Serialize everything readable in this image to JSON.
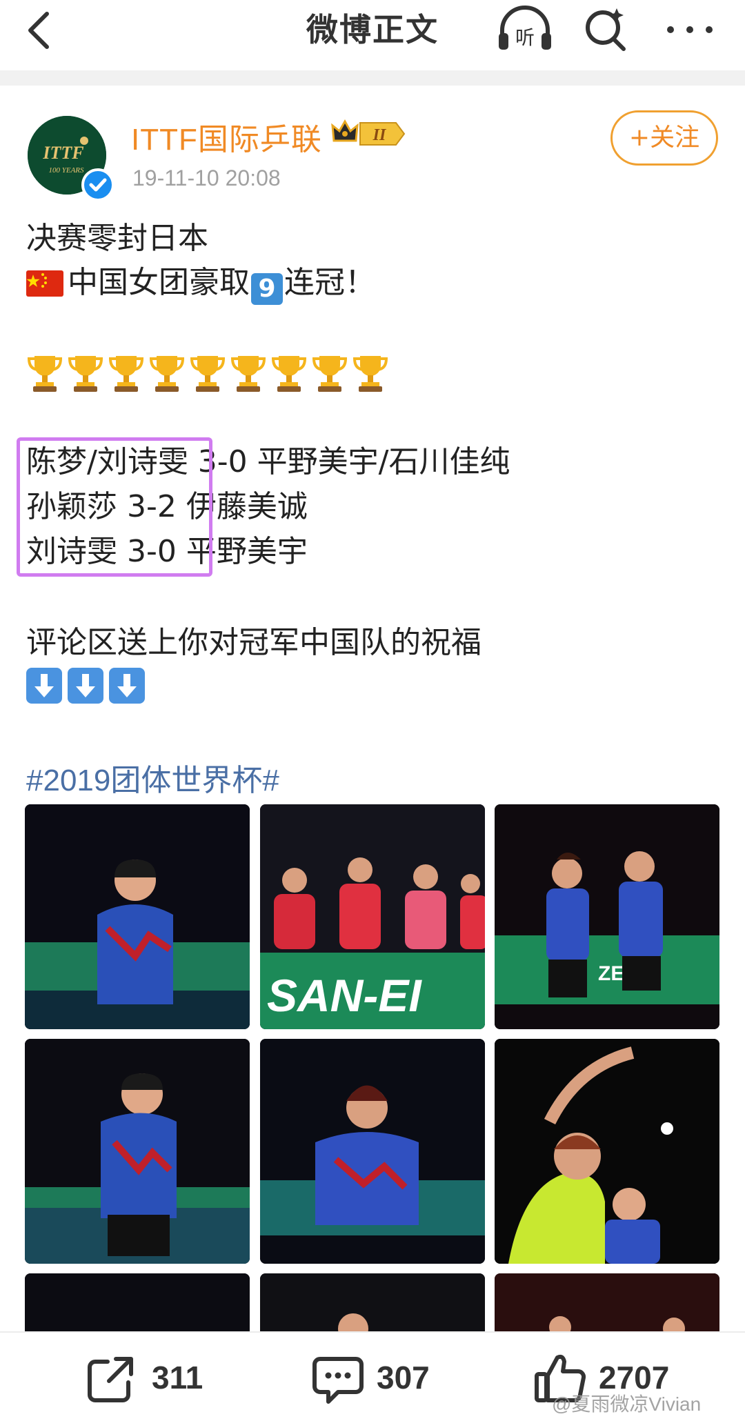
{
  "nav": {
    "title": "微博正文",
    "listen_label": "听"
  },
  "post": {
    "author": "ITTF国际乒联",
    "avatar_text": "ITTF",
    "avatar_subtext": "100 YEARS",
    "badge_level": "II",
    "timestamp": "19-11-10 20:08",
    "follow_label": "+关注",
    "lines": {
      "l1": "决赛零封日本",
      "l2_before": "中国女团豪取",
      "l2_num": "9",
      "l2_after": "连冠！",
      "r1": "陈梦/刘诗雯 3-0 平野美宇/石川佳纯",
      "r2": "孙颖莎 3-2 伊藤美诚",
      "r3": "刘诗雯 3-0 平野美宇",
      "l6": "评论区送上你对冠军中国队的祝福"
    },
    "trophy_count": 9,
    "arrow_count": 3,
    "hashtag": "#2019团体世界杯#",
    "images": [
      {
        "desc": "player-celebrating-1"
      },
      {
        "desc": "coaches-applauding"
      },
      {
        "desc": "players-high-five"
      },
      {
        "desc": "player-celebrating-2"
      },
      {
        "desc": "player-forehand"
      },
      {
        "desc": "player-serving"
      }
    ]
  },
  "actions": {
    "share_count": "311",
    "comment_count": "307",
    "like_count": "2707"
  },
  "watermark": "@夏雨微凉Vivian",
  "colors": {
    "accent_orange": "#f08a25",
    "hashtag_blue": "#4a6fa5",
    "highlight": "#d07cf0",
    "verify_blue": "#1a8ef0"
  }
}
